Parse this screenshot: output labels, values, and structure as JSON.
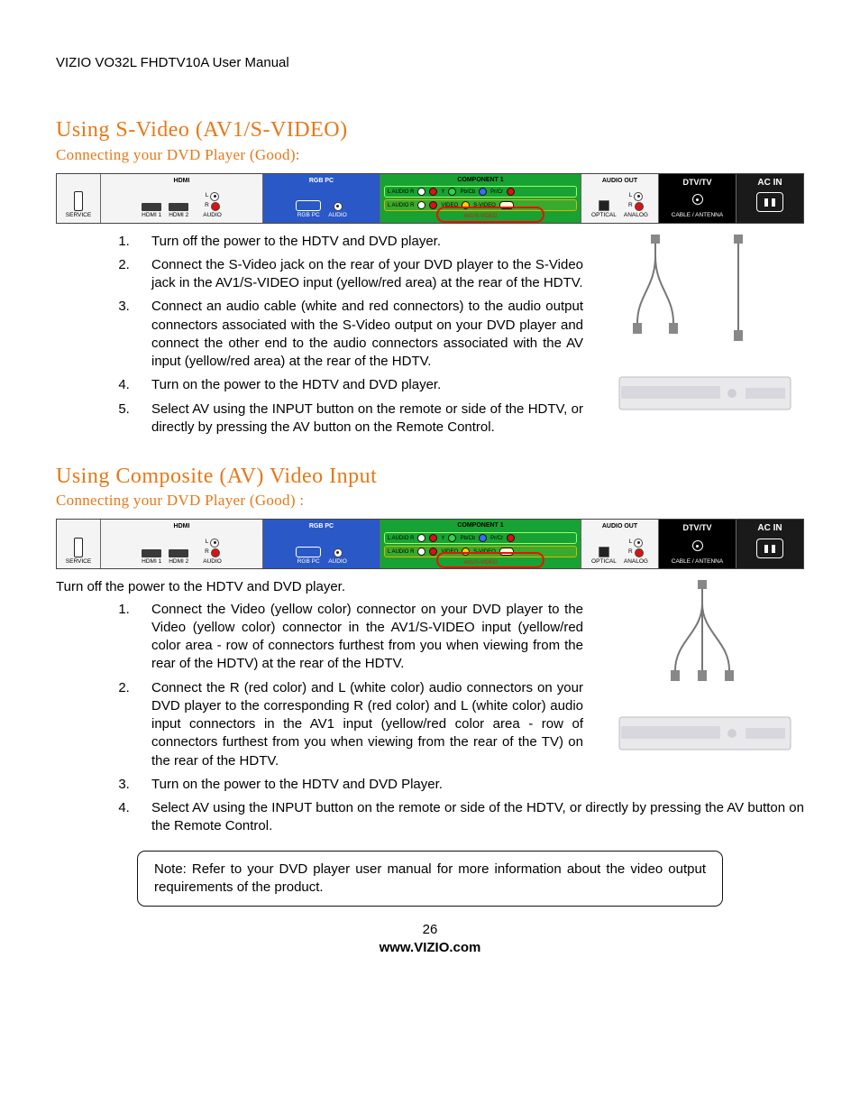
{
  "doc": {
    "header": "VIZIO VO32L FHDTV10A User Manual",
    "page_number": "26",
    "footer_url": "www.VIZIO.com"
  },
  "section1": {
    "title": "Using S-Video (AV1/S-VIDEO)",
    "subtitle": "Connecting your DVD Player (Good):",
    "steps": [
      "Turn off the power to the HDTV and DVD player.",
      "Connect the S-Video jack on the rear of your DVD player to the S-Video jack in the AV1/S-VIDEO input (yellow/red area) at the rear of the HDTV.",
      "Connect an audio cable (white and red connectors) to the audio output connectors associated with the S-Video output on your DVD player and connect the other end to the audio connectors associated with the AV input (yellow/red area) at the rear of the HDTV.",
      "Turn on the power to the HDTV and DVD player.",
      "Select AV using the INPUT button on the remote or side of the HDTV, or directly by pressing the AV button on the Remote Control."
    ]
  },
  "section2": {
    "title": "Using Composite (AV) Video Input",
    "subtitle": "Connecting your DVD Player (Good) :",
    "intro": "Turn off the power to the HDTV and DVD player.",
    "steps": [
      "Connect the Video (yellow color) connector on your DVD player to the Video (yellow color) connector in the AV1/S-VIDEO input (yellow/red color area - row of connectors furthest from you when viewing from the rear of the HDTV) at the rear of the HDTV.",
      "Connect the R (red color) and L (white color) audio connectors on your DVD player to the corresponding R (red color) and L (white color) audio input connectors in the AV1 input (yellow/red color area - row of connectors furthest from you when viewing from the rear of the TV) on the rear of the HDTV.",
      "Turn on the power to the HDTV and DVD Player.",
      "Select AV using the INPUT button on the remote or side of the HDTV, or directly by pressing the AV button on the Remote Control."
    ]
  },
  "note": "Note:  Refer to your DVD player user manual for more information about the video output requirements of the product.",
  "portstrip": {
    "hdmi": "HDMI",
    "service": "SERVICE",
    "hdmi1": "HDMI 1",
    "hdmi2": "HDMI 2",
    "audioL": "L",
    "audioR": "R",
    "audio": "AUDIO",
    "rgbpc": "RGB PC",
    "component1": "COMPONENT 1",
    "audio_lbl": "L AUDIO R",
    "y": "Y",
    "pbcb": "Pb/Cb",
    "prcr": "Pr/Cr",
    "video": "VIDEO",
    "svideo": "S-VIDEO",
    "av1sv": "AV1/S-VIDEO",
    "audio_out": "AUDIO OUT",
    "optical": "OPTICAL",
    "analog": "ANALOG",
    "dtv": "DTV/TV",
    "cable": "CABLE / ANTENNA",
    "acin": "AC IN"
  }
}
